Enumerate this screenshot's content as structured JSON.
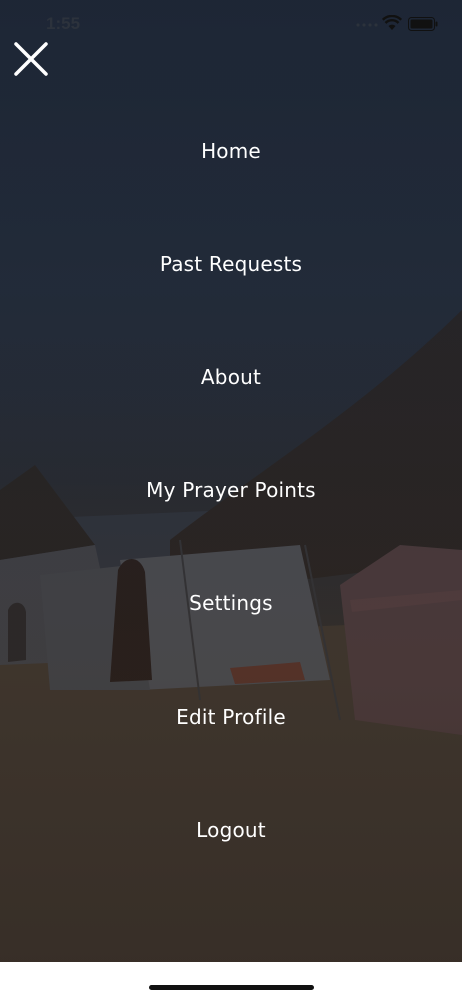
{
  "status_bar": {
    "time": "1:55"
  },
  "icons": {
    "close": "close-icon",
    "wifi": "wifi-icon",
    "battery": "battery-icon",
    "signal": "cellular-signal-icon"
  },
  "menu": {
    "items": [
      {
        "label": "Home"
      },
      {
        "label": "Past Requests"
      },
      {
        "label": "About"
      },
      {
        "label": "My Prayer Points"
      },
      {
        "label": "Settings"
      },
      {
        "label": "Edit Profile"
      },
      {
        "label": "Logout"
      }
    ]
  },
  "colors": {
    "menu_text": "#ffffff",
    "background_top": "#1f2939",
    "background_bottom": "#3a312b"
  }
}
